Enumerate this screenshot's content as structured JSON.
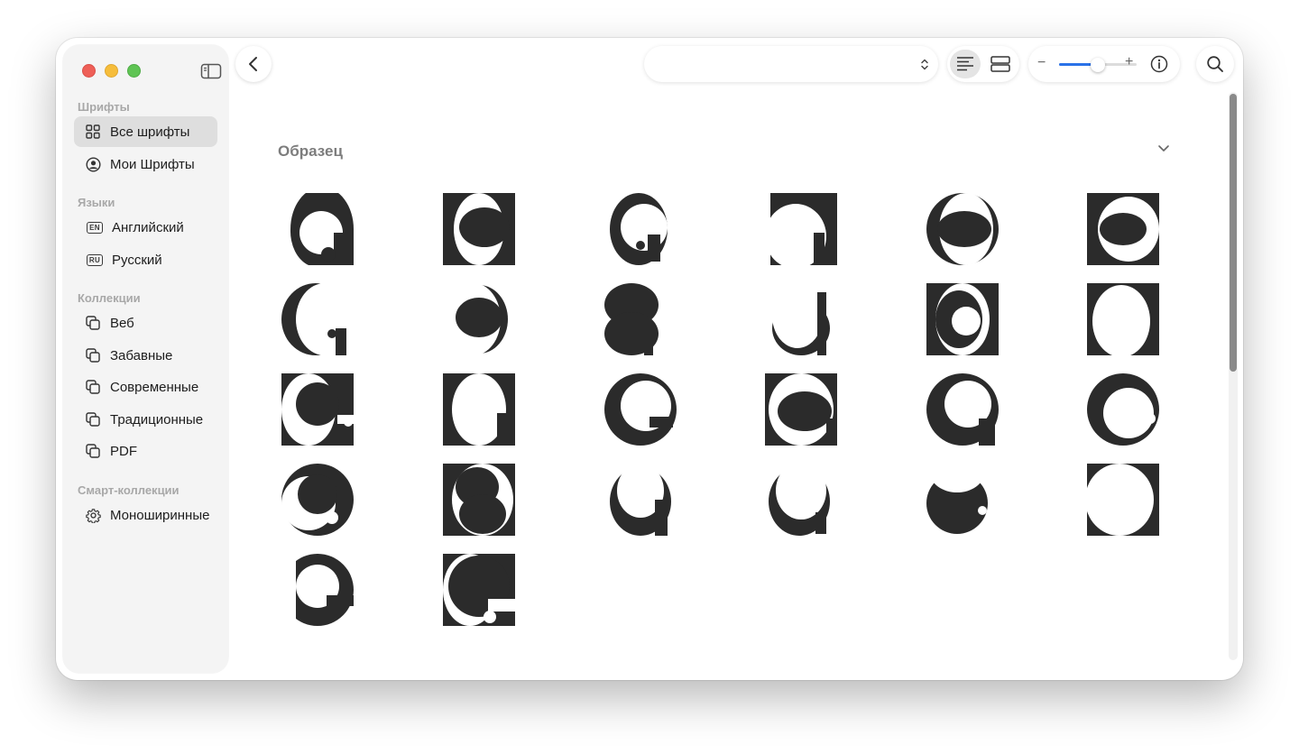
{
  "sidebar": {
    "sections": [
      {
        "title": "Шрифты",
        "items": [
          {
            "label": "Все шрифты",
            "icon": "grid-icon",
            "selected": true
          },
          {
            "label": "Мои Шрифты",
            "icon": "person-circle-icon"
          }
        ]
      },
      {
        "title": "Языки",
        "items": [
          {
            "label": "Английский",
            "icon": "lang-badge-icon",
            "badge": "EN"
          },
          {
            "label": "Русский",
            "icon": "lang-badge-icon",
            "badge": "RU"
          }
        ]
      },
      {
        "title": "Коллекции",
        "items": [
          {
            "label": "Веб",
            "icon": "collection-icon"
          },
          {
            "label": "Забавные",
            "icon": "collection-icon"
          },
          {
            "label": "Современные",
            "icon": "collection-icon"
          },
          {
            "label": "Традиционные",
            "icon": "collection-icon"
          },
          {
            "label": "PDF",
            "icon": "collection-icon"
          }
        ]
      },
      {
        "title": "Смарт-коллекции",
        "items": [
          {
            "label": "Моноширинные",
            "icon": "gear-icon"
          }
        ]
      }
    ]
  },
  "toolbar": {
    "font_select_value": "",
    "active_view": "sample-text",
    "zoom_level": 0.5
  },
  "main": {
    "section_title": "Образец",
    "glyph_count": 26
  },
  "colors": {
    "accent": "#2a72e8",
    "glyph": "#2b2b2b",
    "sidebar_bg": "#f4f4f4",
    "close": "#ee5f57",
    "minimize": "#f6bd3b",
    "maximize": "#5fc454"
  }
}
